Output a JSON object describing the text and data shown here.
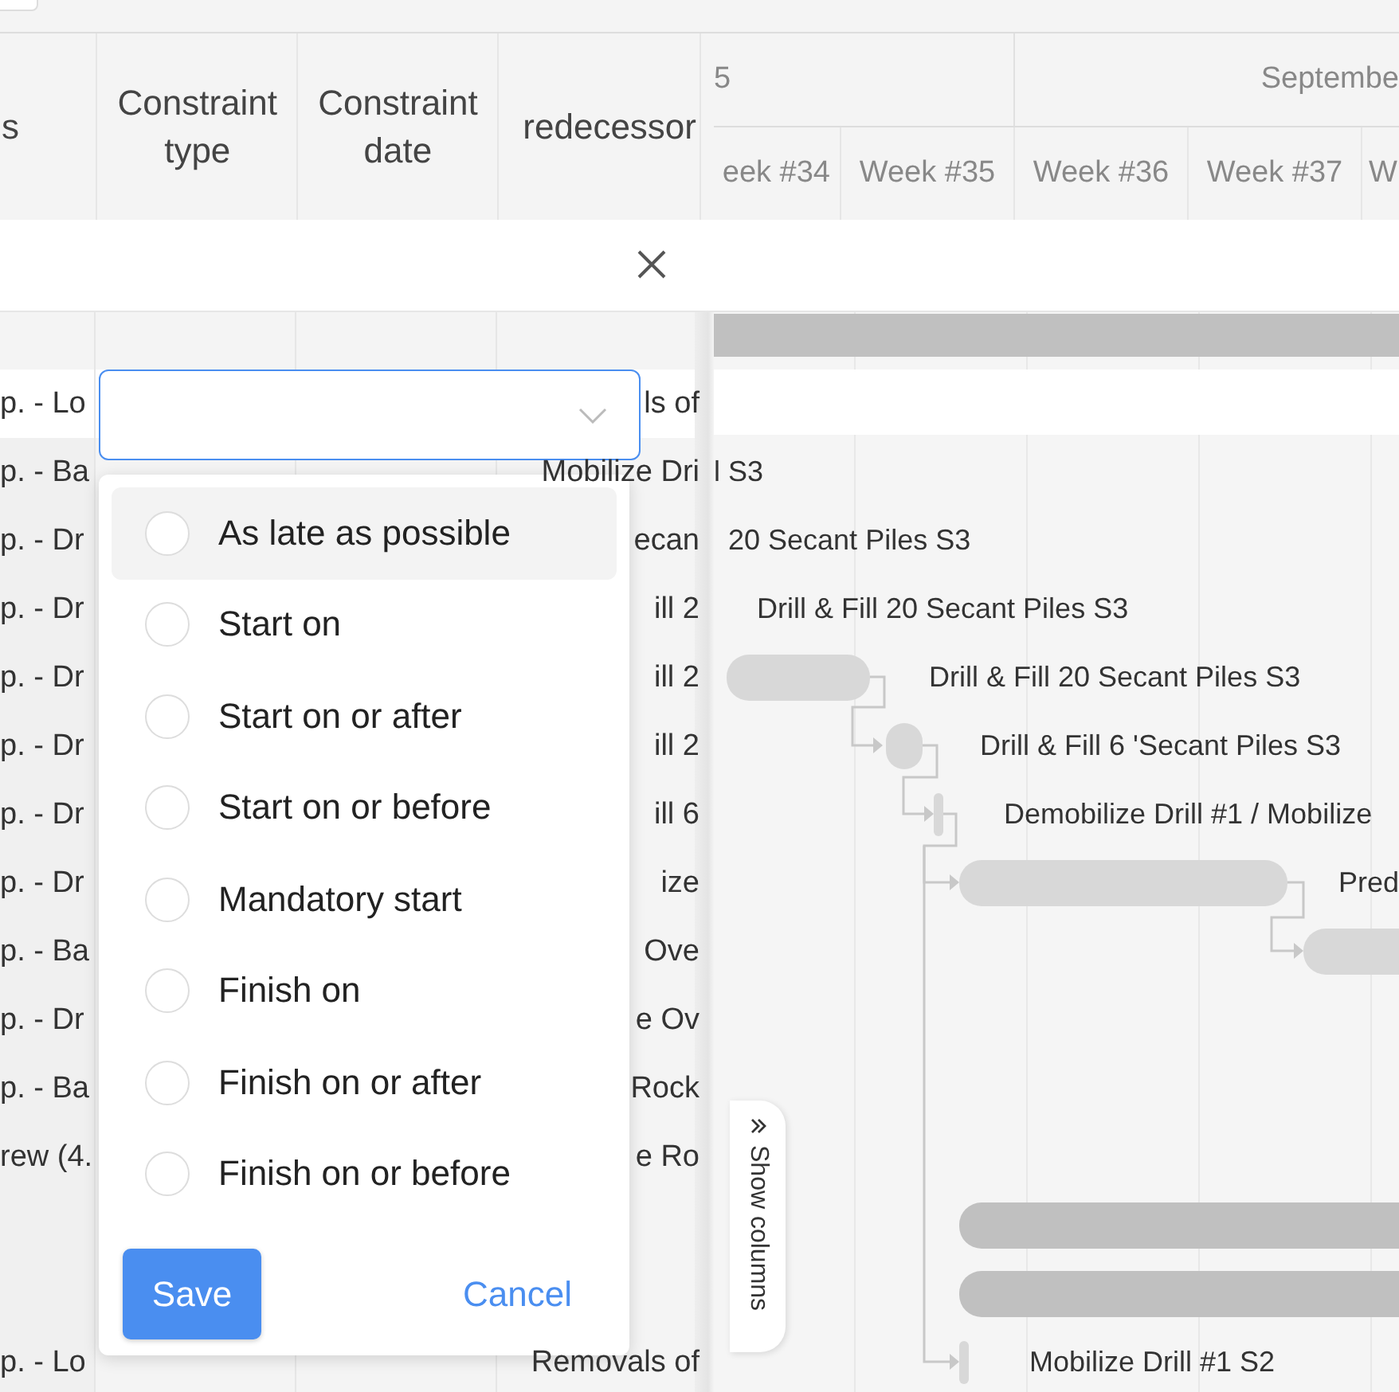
{
  "header": {
    "columns": [
      "s",
      "Constraint type",
      "Constraint date",
      "redecessor"
    ],
    "months": [
      "5",
      "Septembe"
    ],
    "weeks": [
      "eek #34",
      "Week #35",
      "Week #36",
      "Week #37",
      "W"
    ]
  },
  "rows": [
    {
      "name": "p. - Lo",
      "predecessor": "ls of",
      "selected": true,
      "kind": "plain"
    },
    {
      "name": "p. - Ba",
      "predecessor": "Mobilize Dri",
      "selected": false,
      "bar_label": "l S3",
      "kind": "plain"
    },
    {
      "name": "p. - Dr",
      "predecessor": "ecan",
      "selected": false,
      "bar_label": "20 Secant Piles S3",
      "kind": "plain"
    },
    {
      "name": "p. - Dr",
      "predecessor": "ill 2",
      "selected": false,
      "bar_label": "Drill & Fill 20 Secant Piles S3",
      "kind": "plain"
    },
    {
      "name": "p. - Dr",
      "predecessor": "ill 2",
      "selected": false,
      "bar_label": "Drill & Fill 20 Secant Piles S3",
      "kind": "task"
    },
    {
      "name": "p. - Dr",
      "predecessor": "ill 2",
      "selected": false,
      "bar_label": "Drill & Fill 6 'Secant Piles S3",
      "kind": "task"
    },
    {
      "name": "p. - Dr",
      "predecessor": "ill 6",
      "selected": false,
      "bar_label": "Demobilize Drill #1 / Mobilize",
      "kind": "milestone"
    },
    {
      "name": "p. - Dr",
      "predecessor": "ize",
      "selected": false,
      "bar_label": "Pred",
      "kind": "task"
    },
    {
      "name": "p. - Ba",
      "predecessor": "Ove",
      "selected": false,
      "kind": "task"
    },
    {
      "name": "p. - Dr",
      "predecessor": "e Ov",
      "selected": false,
      "kind": "plain"
    },
    {
      "name": "p. - Ba",
      "predecessor": "Rock",
      "selected": false,
      "kind": "plain"
    },
    {
      "name": "rew (4.",
      "predecessor": "e Ro",
      "selected": false,
      "kind": "plain"
    },
    {
      "selected": false,
      "kind": "summary"
    },
    {
      "selected": false,
      "kind": "summary"
    },
    {
      "name": "p. - Lo",
      "predecessor": "Removals of",
      "selected": false,
      "bar_label": "Mobilize Drill #1 S2",
      "kind": "milestone"
    }
  ],
  "dropdown": {
    "options": [
      {
        "label": "As late as possible",
        "selected": false,
        "highlighted": true
      },
      {
        "label": "Start on",
        "selected": false,
        "highlighted": false
      },
      {
        "label": "Start on or after",
        "selected": false,
        "highlighted": false
      },
      {
        "label": "Start on or before",
        "selected": false,
        "highlighted": false
      },
      {
        "label": "Mandatory start",
        "selected": false,
        "highlighted": false
      },
      {
        "label": "Finish on",
        "selected": false,
        "highlighted": false
      },
      {
        "label": "Finish on or after",
        "selected": false,
        "highlighted": false
      },
      {
        "label": "Finish on or before",
        "selected": false,
        "highlighted": false
      }
    ],
    "save": "Save",
    "cancel": "Cancel"
  },
  "show_columns": "Show columns"
}
